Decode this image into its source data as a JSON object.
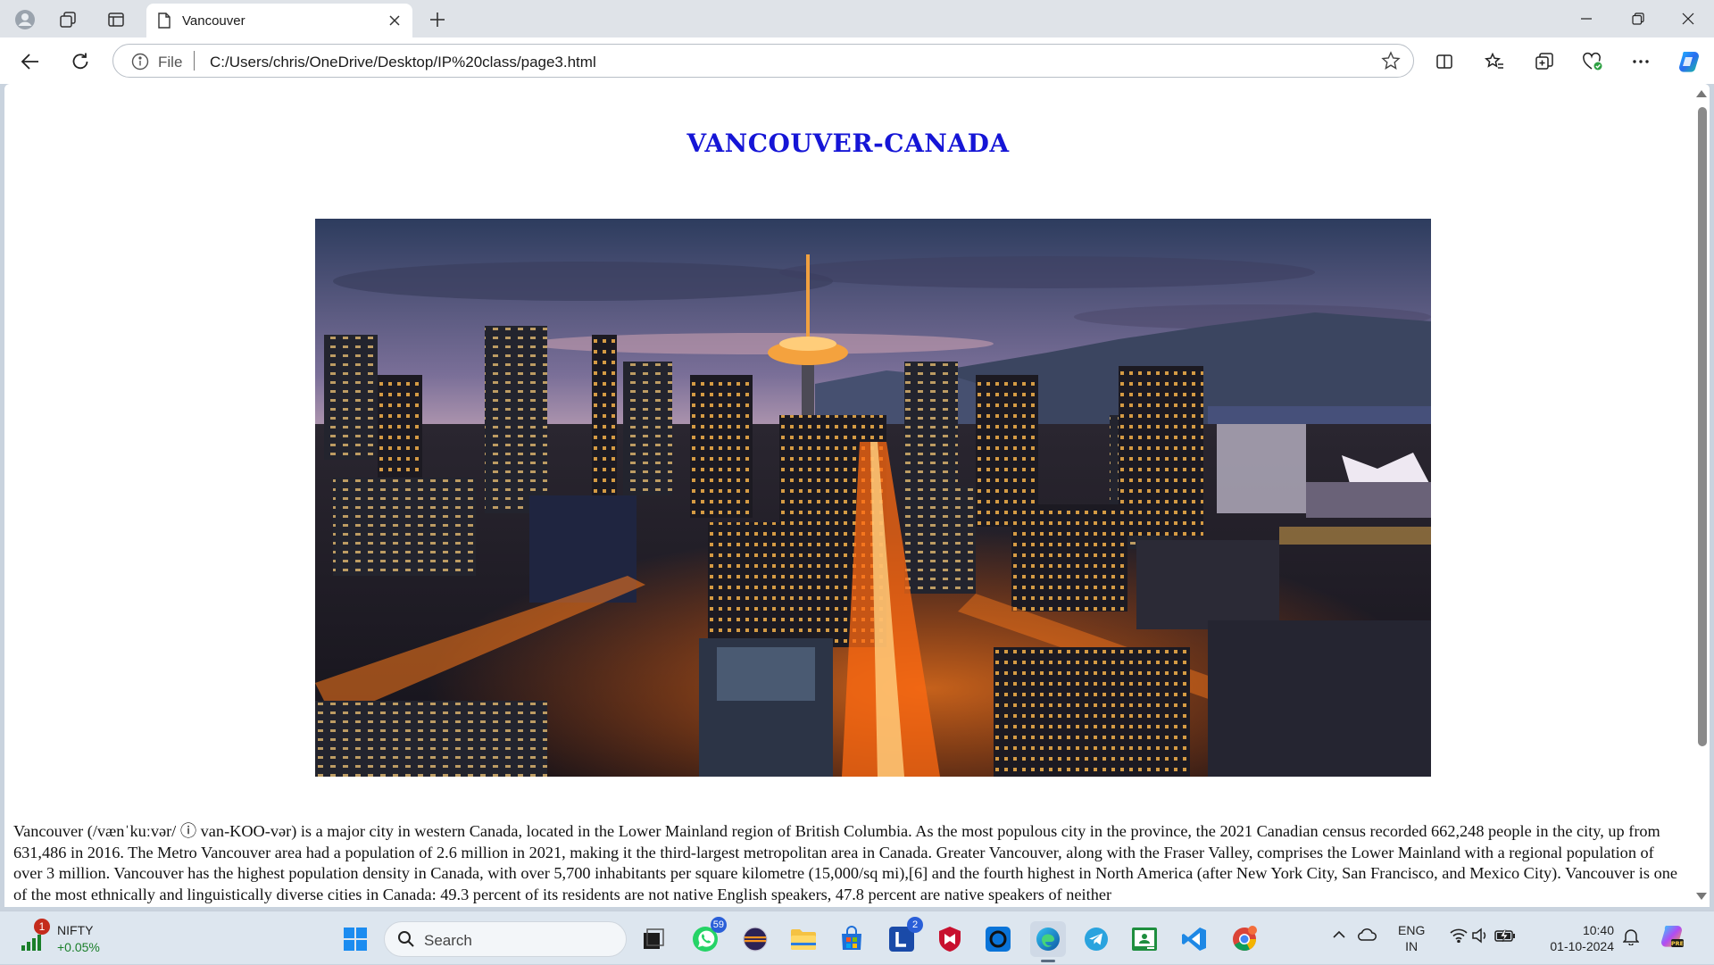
{
  "browser": {
    "tab_title": "Vancouver",
    "url_scheme": "File",
    "url": "C:/Users/chris/OneDrive/Desktop/IP%20class/page3.html"
  },
  "page": {
    "heading": "Vancouver-Canada",
    "image_alt": "Vancouver skyline at dusk",
    "article_text": "Vancouver (/vænˈkuːvər/ ⓘ van-KOO-vər) is a major city in western Canada, located in the Lower Mainland region of British Columbia. As the most populous city in the province, the 2021 Canadian census recorded 662,248 people in the city, up from 631,486 in 2016. The Metro Vancouver area had a population of 2.6 million in 2021, making it the third-largest metropolitan area in Canada. Greater Vancouver, along with the Fraser Valley, comprises the Lower Mainland with a regional population of over 3 million. Vancouver has the highest population density in Canada, with over 5,700 inhabitants per square kilometre (15,000/sq mi),[6] and the fourth highest in North America (after New York City, San Francisco, and Mexico City). Vancouver is one of the most ethnically and linguistically diverse cities in Canada: 49.3 percent of its residents are not native English speakers, 47.8 percent are native speakers of neither"
  },
  "taskbar": {
    "stock_name": "NIFTY",
    "stock_change": "+0.05%",
    "stock_badge": "1",
    "search_placeholder": "Search",
    "whatsapp_badge": "59",
    "app_l_badge": "2",
    "language_line1": "ENG",
    "language_line2": "IN",
    "time": "10:40",
    "date": "01-10-2024"
  },
  "colors": {
    "heading": "#1515d6",
    "accent": "#0067c0"
  }
}
